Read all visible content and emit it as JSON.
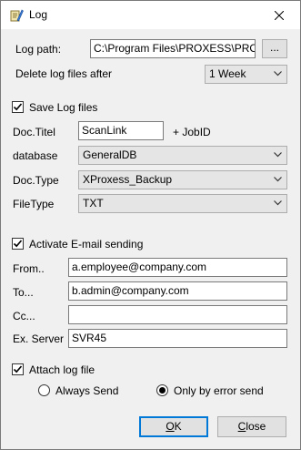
{
  "window": {
    "title": "Log",
    "icons": {
      "app": "log-app-icon",
      "close": "close-icon"
    }
  },
  "log_path": {
    "label": "Log path:",
    "value": "C:\\Program Files\\PROXESS\\PROXE",
    "browse_label": "..."
  },
  "delete_after": {
    "label": "Delete log files after",
    "selected": "1 Week"
  },
  "save_log": {
    "label": "Save Log files",
    "checked": true,
    "doc_titel_label": "Doc.Titel",
    "doc_titel_value": "ScanLink",
    "job_id_suffix": "+ JobID",
    "database_label": "database",
    "database_value": "GeneralDB",
    "doc_type_label": "Doc.Type",
    "doc_type_value": "XProxess_Backup",
    "file_type_label": "FileType",
    "file_type_value": "TXT"
  },
  "email": {
    "label": "Activate E-mail sending",
    "checked": true,
    "from_label": "From..",
    "from_value": "a.employee@company.com",
    "to_label": "To...",
    "to_value": "b.admin@company.com",
    "cc_label": "Cc...",
    "cc_value": "",
    "server_label": "Ex. Server",
    "server_value": "SVR45"
  },
  "attach": {
    "label": "Attach log file",
    "checked": true,
    "always_label": "Always Send",
    "error_label": "Only by error send",
    "selected": "error"
  },
  "buttons": {
    "ok_mnemonic": "O",
    "ok_rest": "K",
    "close_mnemonic": "C",
    "close_rest": "lose"
  }
}
